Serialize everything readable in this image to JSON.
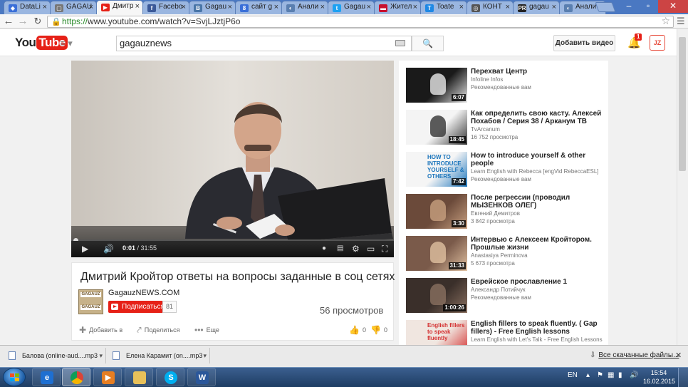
{
  "browser": {
    "tabs": [
      {
        "label": "DataLi",
        "color": "#3a6fd8",
        "glyph": "◆"
      },
      {
        "label": "GAGAU",
        "color": "#777777",
        "glyph": "▢"
      },
      {
        "label": "Дмитр",
        "color": "#e62117",
        "glyph": "▶",
        "active": true
      },
      {
        "label": "Facebo",
        "color": "#3b5998",
        "glyph": "f"
      },
      {
        "label": "Gagau",
        "color": "#4a76a8",
        "glyph": "B"
      },
      {
        "label": "сайт g",
        "color": "#3a6fd8",
        "glyph": "8"
      },
      {
        "label": "Анали",
        "color": "#5a7fb0",
        "glyph": "◐"
      },
      {
        "label": "Gagau",
        "color": "#1da1f2",
        "glyph": "t"
      },
      {
        "label": "Жител",
        "color": "#c8102e",
        "glyph": "▬"
      },
      {
        "label": "Toate",
        "color": "#1e88e5",
        "glyph": "T"
      },
      {
        "label": "КОНТ",
        "color": "#555555",
        "glyph": "◎"
      },
      {
        "label": "gagau",
        "color": "#222222",
        "glyph": "PR"
      },
      {
        "label": "Анали",
        "color": "#5a7fb0",
        "glyph": "◐"
      }
    ],
    "url_scheme": "https://",
    "url_rest": "www.youtube.com/watch?v=SvjLJztjP6o"
  },
  "youtube": {
    "logo_you": "You",
    "logo_tube": "Tube",
    "search_value": "gagauznews",
    "upload_label": "Добавить видео",
    "notif_count": "1",
    "avatar_text": "JZ"
  },
  "player": {
    "time_current": "0:01",
    "time_total": "/ 31:55",
    "progress_fraction": 0.0005
  },
  "video": {
    "title": "Дмитрий Кройтор ответы на вопросы заданные в соц сетях",
    "channel": "GagauzNEWS.COM",
    "channel_logo_text": "GAGAUZ",
    "subscribe_label": "Подписаться",
    "subscriber_count": "81",
    "views": "56 просмотров",
    "add_to": "Добавить в",
    "share": "Поделиться",
    "more": "Еще",
    "likes": "0",
    "dislikes": "0"
  },
  "sidebar": {
    "items": [
      {
        "title": "Перехват Центр",
        "channel": "Infoline Infos",
        "meta": "Рекомендованные вам",
        "duration": "6:07"
      },
      {
        "title": "Как определить свою касту. Алексей Похабов / Серия 38 / Арканум ТВ",
        "channel": "TvArcanum",
        "meta": "16 752 просмотра",
        "duration": "18:45"
      },
      {
        "title": "How to introduce yourself & other people",
        "channel": "Learn English with Rebecca [engVid RebeccaESL]",
        "meta": "Рекомендованные вам",
        "duration": "7:42",
        "thumb_text": "HOW TO INTRODUCE YOURSELF & OTHERS"
      },
      {
        "title": "После регрессии (проводил МЫЗЕНКОВ ОЛЕГ)",
        "channel": "Евгений Демитров",
        "meta": "3 842 просмотра",
        "duration": "3:30"
      },
      {
        "title": "Интервью с Алексеем Кройтором. Прошлые жизни",
        "channel": "Anastasiya Perminova",
        "meta": "5 673 просмотра",
        "duration": "31:33"
      },
      {
        "title": "Еврейское прославление 1",
        "channel": "Александр Потийчук",
        "meta": "Рекомендованные вам",
        "duration": "1:00:26"
      },
      {
        "title": "English fillers to speak fluently. ( Gap fillers) - Free English lessons",
        "channel": "Learn English with Let's Talk - Free English Lessons",
        "meta": "",
        "duration": "",
        "thumb_text": "English fillers to speak fluently"
      }
    ]
  },
  "downloads": {
    "items": [
      {
        "name": "Балова (online-aud....mp3"
      },
      {
        "name": "Елена Карамит (on....mp3"
      }
    ],
    "show_all": "Все скачанные файлы..."
  },
  "taskbar": {
    "lang": "EN",
    "time": "15:54",
    "date": "16.02.2015"
  }
}
